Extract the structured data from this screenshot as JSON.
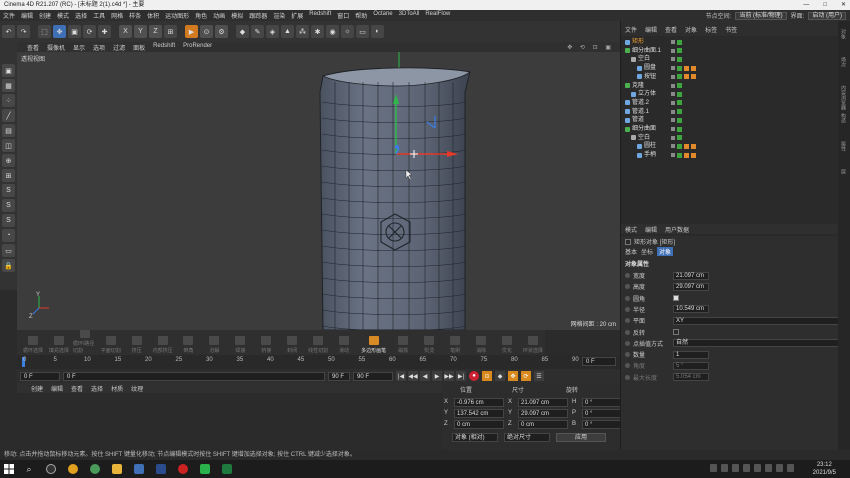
{
  "title": "Cinema 4D R21.207 (RC) - [未标题 2(1).c4d *] - 主要",
  "window_controls": [
    "—",
    "□",
    "✕"
  ],
  "menu": [
    "文件",
    "编辑",
    "创建",
    "模式",
    "选择",
    "工具",
    "网格",
    "样条",
    "体积",
    "运动图形",
    "角色",
    "动画",
    "模拟",
    "跟踪器",
    "渲染",
    "扩展",
    "Redshift",
    "窗口",
    "帮助",
    "Octane",
    "3DToAll",
    "RealFlow"
  ],
  "layout": {
    "node_space_label": "节点空间:",
    "node_space_value": "当前 (标准/物理)",
    "interface_label": "界面:",
    "interface_value": "启动 (用户)"
  },
  "toolbar_icons": [
    "undo-icon",
    "redo-icon",
    "select-icon",
    "move-icon",
    "scale-icon",
    "rotate-icon",
    "add-icon",
    "x-axis-icon",
    "y-axis-icon",
    "z-axis-icon",
    "coord-icon",
    "render-view-icon",
    "render-icon",
    "render-settings-icon",
    "cube-icon",
    "pen-icon",
    "subdivision-icon",
    "extrude-icon",
    "cloner-icon",
    "deformer-icon",
    "camera-icon",
    "light-icon",
    "floor-icon",
    "sky-icon"
  ],
  "toolbar_axis_labels": [
    "X",
    "Y",
    "Z"
  ],
  "viewport_menu": [
    "查看",
    "摄像机",
    "显示",
    "选项",
    "过滤",
    "面板",
    "Redshift",
    "ProRender"
  ],
  "viewport": {
    "name": "透视视图",
    "grid_spacing": "网格间距 : 20 cm",
    "axis_y": "Y",
    "axis_z": "Z",
    "axis_x": "X"
  },
  "left_tools": [
    "model-mode-icon",
    "texture-mode-icon",
    "points-mode-icon",
    "edges-mode-icon",
    "polygons-mode-icon",
    "uv-icon",
    "axis-icon",
    "snap-icon",
    "s1-icon",
    "s2-icon",
    "s3-icon",
    "soft-select-icon",
    "workplane-icon",
    "lock-icon"
  ],
  "left_tool_labels": [
    "S",
    "S",
    "S"
  ],
  "anim_tools": [
    {
      "label": "循环选择",
      "active": false
    },
    {
      "label": "填充选择",
      "active": false
    },
    {
      "label": "循环/路径切割",
      "active": false
    },
    {
      "label": "平面切割",
      "active": false
    },
    {
      "label": "挤压",
      "active": false
    },
    {
      "label": "内部挤压",
      "active": false
    },
    {
      "label": "倒角",
      "active": false
    },
    {
      "label": "溶解",
      "active": false
    },
    {
      "label": "焊接",
      "active": false
    },
    {
      "label": "桥接",
      "active": false
    },
    {
      "label": "封闭",
      "active": false
    },
    {
      "label": "线性切割",
      "active": false
    },
    {
      "label": "滑动",
      "active": false
    },
    {
      "label": "多边形画笔",
      "active": true
    },
    {
      "label": "磁铁",
      "active": false
    },
    {
      "label": "熨烫",
      "active": false
    },
    {
      "label": "笔刷",
      "active": false
    },
    {
      "label": "消除",
      "active": false
    },
    {
      "label": "优化",
      "active": false
    },
    {
      "label": "环状选择",
      "active": false
    }
  ],
  "timeline": {
    "ticks": [
      "0",
      "5",
      "10",
      "15",
      "20",
      "25",
      "30",
      "35",
      "40",
      "45",
      "50",
      "55",
      "60",
      "65",
      "70",
      "75",
      "80",
      "85",
      "90"
    ],
    "frame_field": "0 F"
  },
  "transport": {
    "start": "0 F",
    "current": "0 F",
    "end_a": "90 F",
    "end_b": "90 F",
    "buttons": [
      "|◀",
      "◀◀",
      "◀",
      "▶",
      "▶▶",
      "▶|"
    ]
  },
  "material_menu": [
    "创建",
    "编辑",
    "查看",
    "选择",
    "材质",
    "纹理"
  ],
  "coords": {
    "headers": [
      "位置",
      "尺寸",
      "旋转"
    ],
    "rows": [
      {
        "axis": "X",
        "pos": "-0.976 cm",
        "size_axis": "X",
        "size": "21.097 cm",
        "rot_axis": "H",
        "rot": "0 °"
      },
      {
        "axis": "Y",
        "pos": "137.542 cm",
        "size_axis": "Y",
        "size": "29.097 cm",
        "rot_axis": "P",
        "rot": "0 °"
      },
      {
        "axis": "Z",
        "pos": "0 cm",
        "size_axis": "Z",
        "size": "0 cm",
        "rot_axis": "B",
        "rot": "0 °"
      }
    ],
    "mode": "对象 (相对)",
    "size_mode": "绝对尺寸",
    "apply": "应用"
  },
  "status": "移动: 点击并拖动鼠标移动元素。按住 SHIFT 键量化移动; 节点编辑模式时按住 SHIFT 键增加选择对象; 按住 CTRL 键减少选择对象。",
  "object_menu": [
    "文件",
    "编辑",
    "查看",
    "对象",
    "标签",
    "书签"
  ],
  "objects": [
    {
      "name": "矩形",
      "indent": 0,
      "color": "#6fa7e0",
      "selected": true
    },
    {
      "name": "细分曲面.1",
      "indent": 0,
      "color": "#4caf50",
      "selected": false
    },
    {
      "name": "空白",
      "indent": 1,
      "color": "#aaaaaa",
      "selected": false
    },
    {
      "name": "圆盘",
      "indent": 2,
      "color": "#6fa7e0",
      "selected": false
    },
    {
      "name": "按钮",
      "indent": 2,
      "color": "#6fa7e0",
      "selected": false
    },
    {
      "name": "克隆",
      "indent": 0,
      "color": "#4caf50",
      "selected": false
    },
    {
      "name": "立方体",
      "indent": 1,
      "color": "#6fa7e0",
      "selected": false
    },
    {
      "name": "管道.2",
      "indent": 0,
      "color": "#6fa7e0",
      "selected": false
    },
    {
      "name": "管道.1",
      "indent": 0,
      "color": "#6fa7e0",
      "selected": false
    },
    {
      "name": "管道",
      "indent": 0,
      "color": "#6fa7e0",
      "selected": false
    },
    {
      "name": "细分曲面",
      "indent": 0,
      "color": "#4caf50",
      "selected": false
    },
    {
      "name": "空白",
      "indent": 1,
      "color": "#aaaaaa",
      "selected": false
    },
    {
      "name": "圆柱",
      "indent": 2,
      "color": "#6fa7e0",
      "selected": false
    },
    {
      "name": "手柄",
      "indent": 2,
      "color": "#6fa7e0",
      "selected": false
    }
  ],
  "attr_menu": [
    "模式",
    "编辑",
    "用户数据"
  ],
  "attr": {
    "object_title": "矩形对象 [矩形]",
    "tabs": [
      "基本",
      "坐标",
      "对象"
    ],
    "section": "对象属性",
    "fields": [
      {
        "label": "宽度",
        "value": "21.097 cm",
        "type": "num"
      },
      {
        "label": "高度",
        "value": "29.097 cm",
        "type": "num"
      },
      {
        "label": "圆角",
        "value": "",
        "type": "check"
      },
      {
        "label": "半径",
        "value": "10.549 cm",
        "type": "num"
      },
      {
        "label": "平面",
        "value": "XY",
        "type": "select"
      },
      {
        "label": "反转",
        "value": "",
        "type": "checkoff"
      },
      {
        "label": "点插值方式",
        "value": "自然",
        "type": "select"
      },
      {
        "label": "数量",
        "value": "1",
        "type": "num"
      },
      {
        "label": "角度",
        "value": "5 °",
        "type": "disabled"
      },
      {
        "label": "最大长度",
        "value": "5.054 cm",
        "type": "disabled"
      }
    ]
  },
  "right_strip_tabs": [
    "对象",
    "场次",
    "内容浏览器",
    "构造",
    "属性",
    "层"
  ],
  "taskbar": {
    "time": "23:12",
    "date": "2021/9/5"
  },
  "colors": {
    "accent": "#3f6fb5",
    "orange": "#d98a1e",
    "viewport_bg": "#3c3c3c"
  }
}
